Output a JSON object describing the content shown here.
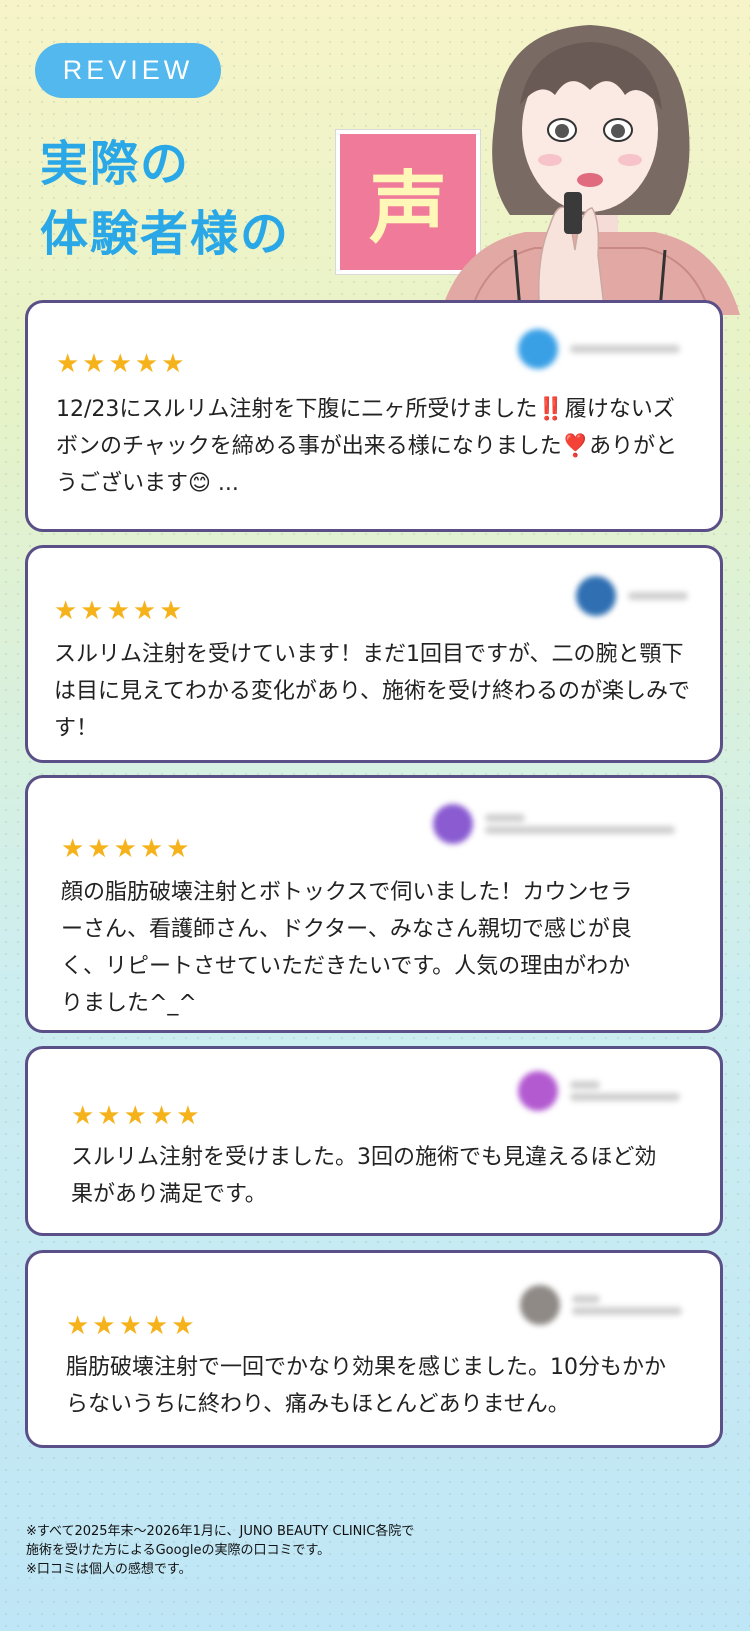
{
  "header": {
    "badge": "REVIEW",
    "title_line1": "実際の",
    "title_line2": "体験者様の",
    "title_highlight": "声"
  },
  "reviews": [
    {
      "stars": "★★★★★",
      "rating": 5,
      "text": "12/23にスルリム注射を下腹に二ヶ所受けました‼️履けないズボンのチャックを締める事が出来る様になりました❣️ありがとうございます😊 ...",
      "avatar_color": "#3aa0e6"
    },
    {
      "stars": "★★★★★",
      "rating": 5,
      "text": "スルリム注射を受けています！まだ1回目ですが、二の腕と顎下は目に見えてわかる変化があり、施術を受け終わるのが楽しみです！",
      "avatar_color": "#2f6fb2"
    },
    {
      "stars": "★★★★★",
      "rating": 5,
      "text": "顔の脂肪破壊注射とボトックスで伺いました！カウンセラーさん、看護師さん、ドクター、みなさん親切で感じが良く、リピートさせていただきたいです。人気の理由がわかりました^_^",
      "avatar_color": "#8a5bd1"
    },
    {
      "stars": "★★★★★",
      "rating": 5,
      "text": "スルリム注射を受けました。3回の施術でも見違えるほど効果があり満足です。",
      "avatar_color": "#b35ad1"
    },
    {
      "stars": "★★★★★",
      "rating": 5,
      "text": "脂肪破壊注射で一回でかなり効果を感じました。10分もかからないうちに終わり、痛みもほとんどありません。",
      "avatar_color": "#8f8a86"
    }
  ],
  "footer": {
    "line1": "※すべて2025年末〜2026年1月に、JUNO BEAUTY CLINIC各院で",
    "line2": "施術を受けた方によるGoogleの実際の口コミです。",
    "line3": "※口コミは個人の感想です。"
  }
}
